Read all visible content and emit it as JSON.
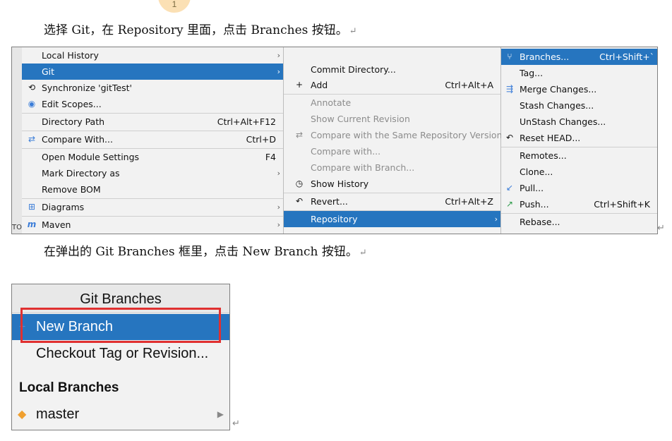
{
  "page_badge": "1",
  "paragraph1": {
    "text": "选择 Git，在 Repository 里面，点击 Branches 按钮。",
    "return_mark": "↵"
  },
  "paragraph2": {
    "text": "在弹出的 Git Branches 框里，点击 New Branch 按钮。",
    "return_mark": "↵"
  },
  "left_strip_text": "TO",
  "menu1": {
    "items": [
      {
        "label": "Local History",
        "shortcut": "",
        "arrow": "›",
        "icon": ""
      },
      {
        "label": "Git",
        "shortcut": "",
        "arrow": "›",
        "icon": "",
        "selected": true
      },
      {
        "label": "Synchronize 'gitTest'",
        "shortcut": "",
        "arrow": "",
        "icon": "sync-icon"
      },
      {
        "label": "Edit Scopes...",
        "shortcut": "",
        "arrow": "",
        "icon": "scope-icon"
      },
      {
        "label": "Directory Path",
        "shortcut": "Ctrl+Alt+F12",
        "arrow": "",
        "icon": ""
      },
      {
        "label": "Compare With...",
        "shortcut": "Ctrl+D",
        "arrow": "",
        "icon": "compare-icon"
      },
      {
        "label": "Open Module Settings",
        "shortcut": "F4",
        "arrow": "",
        "icon": ""
      },
      {
        "label": "Mark Directory as",
        "shortcut": "",
        "arrow": "›",
        "icon": ""
      },
      {
        "label": "Remove BOM",
        "shortcut": "",
        "arrow": "",
        "icon": ""
      },
      {
        "label": "Diagrams",
        "shortcut": "",
        "arrow": "›",
        "icon": "diagram-icon"
      },
      {
        "label": "Maven",
        "shortcut": "",
        "arrow": "›",
        "icon": "maven-icon"
      }
    ]
  },
  "menu2": {
    "items": [
      {
        "label": "Commit Directory...",
        "shortcut": "",
        "icon": ""
      },
      {
        "label": "Add",
        "shortcut": "Ctrl+Alt+A",
        "icon": "plus-icon"
      },
      {
        "label": "Annotate",
        "shortcut": "",
        "icon": "",
        "disabled": true
      },
      {
        "label": "Show Current Revision",
        "shortcut": "",
        "icon": "",
        "disabled": true
      },
      {
        "label": "Compare with the Same Repository Version",
        "shortcut": "",
        "icon": "compare-icon",
        "disabled": true
      },
      {
        "label": "Compare with...",
        "shortcut": "",
        "icon": "",
        "disabled": true
      },
      {
        "label": "Compare with Branch...",
        "shortcut": "",
        "icon": "",
        "disabled": true
      },
      {
        "label": "Show History",
        "shortcut": "",
        "icon": "clock-icon"
      },
      {
        "label": "Revert...",
        "shortcut": "Ctrl+Alt+Z",
        "icon": "revert-icon"
      },
      {
        "label": "Repository",
        "shortcut": "",
        "icon": "",
        "selected": true,
        "arrow": "›"
      }
    ]
  },
  "menu3": {
    "items": [
      {
        "label": "Branches...",
        "shortcut": "Ctrl+Shift+`",
        "icon": "branch-icon",
        "selected": true
      },
      {
        "label": "Tag...",
        "shortcut": "",
        "icon": ""
      },
      {
        "label": "Merge Changes...",
        "shortcut": "",
        "icon": "merge-icon"
      },
      {
        "label": "Stash Changes...",
        "shortcut": "",
        "icon": ""
      },
      {
        "label": "UnStash Changes...",
        "shortcut": "",
        "icon": ""
      },
      {
        "label": "Reset HEAD...",
        "shortcut": "",
        "icon": "reset-icon"
      },
      {
        "label": "Remotes...",
        "shortcut": "",
        "icon": ""
      },
      {
        "label": "Clone...",
        "shortcut": "",
        "icon": ""
      },
      {
        "label": "Pull...",
        "shortcut": "",
        "icon": "pull-icon"
      },
      {
        "label": "Push...",
        "shortcut": "Ctrl+Shift+K",
        "icon": "push-icon"
      },
      {
        "label": "Rebase...",
        "shortcut": "",
        "icon": ""
      }
    ]
  },
  "git_branches": {
    "title": "Git Branches",
    "new_branch": "New Branch",
    "checkout": "Checkout Tag or Revision...",
    "local_header": "Local Branches",
    "branch": "master",
    "branch_arrow": "▶"
  },
  "colors": {
    "selection": "#2675bf",
    "highlight_box": "#e03030",
    "menu_bg": "#f2f2f2"
  }
}
